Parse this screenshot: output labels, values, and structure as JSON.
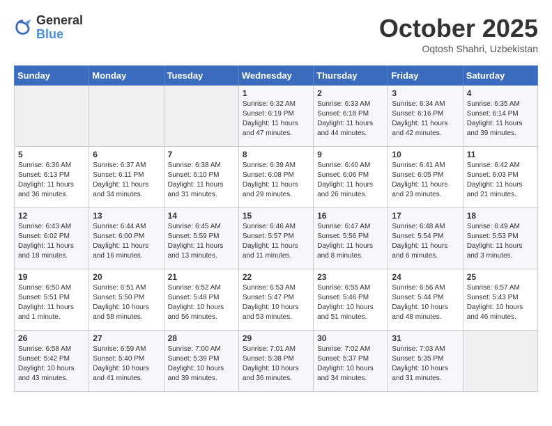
{
  "logo": {
    "general": "General",
    "blue": "Blue"
  },
  "header": {
    "month": "October 2025",
    "location": "Oqtosh Shahri, Uzbekistan"
  },
  "days_of_week": [
    "Sunday",
    "Monday",
    "Tuesday",
    "Wednesday",
    "Thursday",
    "Friday",
    "Saturday"
  ],
  "weeks": [
    [
      {
        "day": "",
        "info": ""
      },
      {
        "day": "",
        "info": ""
      },
      {
        "day": "",
        "info": ""
      },
      {
        "day": "1",
        "info": "Sunrise: 6:32 AM\nSunset: 6:19 PM\nDaylight: 11 hours\nand 47 minutes."
      },
      {
        "day": "2",
        "info": "Sunrise: 6:33 AM\nSunset: 6:18 PM\nDaylight: 11 hours\nand 44 minutes."
      },
      {
        "day": "3",
        "info": "Sunrise: 6:34 AM\nSunset: 6:16 PM\nDaylight: 11 hours\nand 42 minutes."
      },
      {
        "day": "4",
        "info": "Sunrise: 6:35 AM\nSunset: 6:14 PM\nDaylight: 11 hours\nand 39 minutes."
      }
    ],
    [
      {
        "day": "5",
        "info": "Sunrise: 6:36 AM\nSunset: 6:13 PM\nDaylight: 11 hours\nand 36 minutes."
      },
      {
        "day": "6",
        "info": "Sunrise: 6:37 AM\nSunset: 6:11 PM\nDaylight: 11 hours\nand 34 minutes."
      },
      {
        "day": "7",
        "info": "Sunrise: 6:38 AM\nSunset: 6:10 PM\nDaylight: 11 hours\nand 31 minutes."
      },
      {
        "day": "8",
        "info": "Sunrise: 6:39 AM\nSunset: 6:08 PM\nDaylight: 11 hours\nand 29 minutes."
      },
      {
        "day": "9",
        "info": "Sunrise: 6:40 AM\nSunset: 6:06 PM\nDaylight: 11 hours\nand 26 minutes."
      },
      {
        "day": "10",
        "info": "Sunrise: 6:41 AM\nSunset: 6:05 PM\nDaylight: 11 hours\nand 23 minutes."
      },
      {
        "day": "11",
        "info": "Sunrise: 6:42 AM\nSunset: 6:03 PM\nDaylight: 11 hours\nand 21 minutes."
      }
    ],
    [
      {
        "day": "12",
        "info": "Sunrise: 6:43 AM\nSunset: 6:02 PM\nDaylight: 11 hours\nand 18 minutes."
      },
      {
        "day": "13",
        "info": "Sunrise: 6:44 AM\nSunset: 6:00 PM\nDaylight: 11 hours\nand 16 minutes."
      },
      {
        "day": "14",
        "info": "Sunrise: 6:45 AM\nSunset: 5:59 PM\nDaylight: 11 hours\nand 13 minutes."
      },
      {
        "day": "15",
        "info": "Sunrise: 6:46 AM\nSunset: 5:57 PM\nDaylight: 11 hours\nand 11 minutes."
      },
      {
        "day": "16",
        "info": "Sunrise: 6:47 AM\nSunset: 5:56 PM\nDaylight: 11 hours\nand 8 minutes."
      },
      {
        "day": "17",
        "info": "Sunrise: 6:48 AM\nSunset: 5:54 PM\nDaylight: 11 hours\nand 6 minutes."
      },
      {
        "day": "18",
        "info": "Sunrise: 6:49 AM\nSunset: 5:53 PM\nDaylight: 11 hours\nand 3 minutes."
      }
    ],
    [
      {
        "day": "19",
        "info": "Sunrise: 6:50 AM\nSunset: 5:51 PM\nDaylight: 11 hours\nand 1 minute."
      },
      {
        "day": "20",
        "info": "Sunrise: 6:51 AM\nSunset: 5:50 PM\nDaylight: 10 hours\nand 58 minutes."
      },
      {
        "day": "21",
        "info": "Sunrise: 6:52 AM\nSunset: 5:48 PM\nDaylight: 10 hours\nand 56 minutes."
      },
      {
        "day": "22",
        "info": "Sunrise: 6:53 AM\nSunset: 5:47 PM\nDaylight: 10 hours\nand 53 minutes."
      },
      {
        "day": "23",
        "info": "Sunrise: 6:55 AM\nSunset: 5:46 PM\nDaylight: 10 hours\nand 51 minutes."
      },
      {
        "day": "24",
        "info": "Sunrise: 6:56 AM\nSunset: 5:44 PM\nDaylight: 10 hours\nand 48 minutes."
      },
      {
        "day": "25",
        "info": "Sunrise: 6:57 AM\nSunset: 5:43 PM\nDaylight: 10 hours\nand 46 minutes."
      }
    ],
    [
      {
        "day": "26",
        "info": "Sunrise: 6:58 AM\nSunset: 5:42 PM\nDaylight: 10 hours\nand 43 minutes."
      },
      {
        "day": "27",
        "info": "Sunrise: 6:59 AM\nSunset: 5:40 PM\nDaylight: 10 hours\nand 41 minutes."
      },
      {
        "day": "28",
        "info": "Sunrise: 7:00 AM\nSunset: 5:39 PM\nDaylight: 10 hours\nand 39 minutes."
      },
      {
        "day": "29",
        "info": "Sunrise: 7:01 AM\nSunset: 5:38 PM\nDaylight: 10 hours\nand 36 minutes."
      },
      {
        "day": "30",
        "info": "Sunrise: 7:02 AM\nSunset: 5:37 PM\nDaylight: 10 hours\nand 34 minutes."
      },
      {
        "day": "31",
        "info": "Sunrise: 7:03 AM\nSunset: 5:35 PM\nDaylight: 10 hours\nand 31 minutes."
      },
      {
        "day": "",
        "info": ""
      }
    ]
  ]
}
